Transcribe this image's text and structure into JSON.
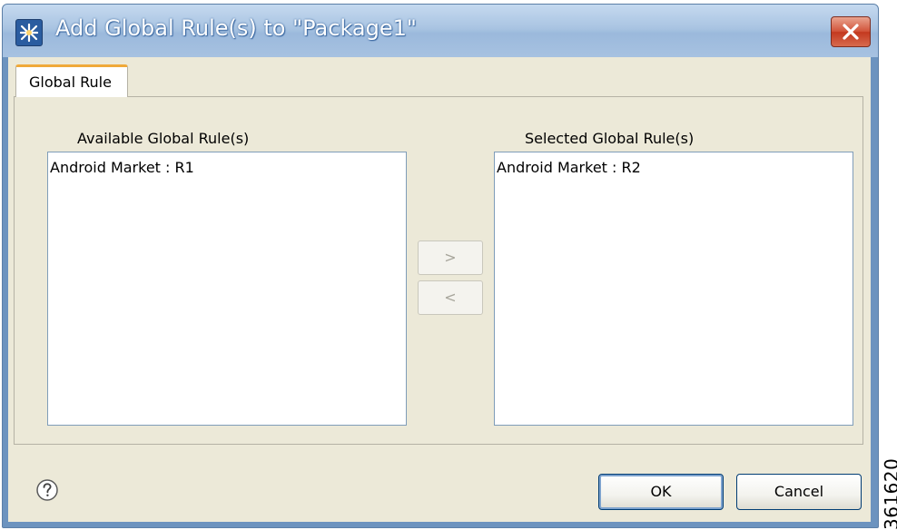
{
  "window": {
    "title": "Add Global Rule(s) to \"Package1\""
  },
  "tabs": [
    {
      "label": "Global Rule",
      "active": true
    }
  ],
  "available": {
    "label": "Available Global Rule(s)",
    "items": [
      "Android Market : R1"
    ]
  },
  "selected": {
    "label": "Selected Global Rule(s)",
    "items": [
      "Android Market : R2"
    ]
  },
  "transfer": {
    "add_label": ">",
    "remove_label": "<"
  },
  "footer": {
    "ok_label": "OK",
    "cancel_label": "Cancel"
  },
  "figure_code": "361620",
  "icons": {
    "app": "package-icon",
    "close": "close-icon",
    "help": "help-icon"
  },
  "colors": {
    "title_bar": "#a9c4e2",
    "close_button": "#c3391f",
    "dialog_background": "#ece9d8",
    "tab_accent": "#f0a93a"
  }
}
